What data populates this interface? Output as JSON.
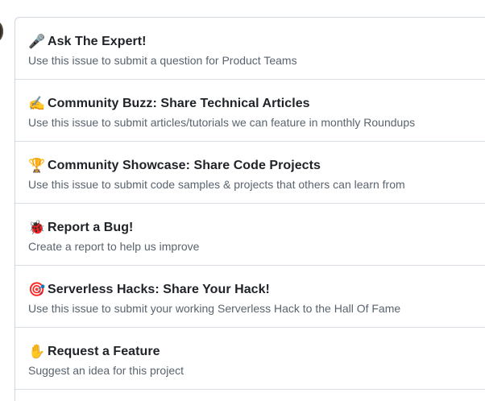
{
  "templates": [
    {
      "emoji": "🎤",
      "icon": "microphone-icon",
      "title": "Ask The Expert!",
      "description": "Use this issue to submit a question for Product Teams"
    },
    {
      "emoji": "✍️",
      "icon": "writing-hand-icon",
      "title": "Community Buzz: Share Technical Articles",
      "description": "Use this issue to submit articles/tutorials we can feature in monthly Roundups"
    },
    {
      "emoji": "🏆",
      "icon": "trophy-icon",
      "title": "Community Showcase: Share Code Projects",
      "description": "Use this issue to submit code samples & projects that others can learn from"
    },
    {
      "emoji": "🐞",
      "icon": "ladybug-icon",
      "title": "Report a Bug!",
      "description": "Create a report to help us improve"
    },
    {
      "emoji": "🎯",
      "icon": "target-icon",
      "title": "Serverless Hacks: Share Your Hack!",
      "description": "Use this issue to submit your working Serverless Hack to the Hall Of Fame"
    },
    {
      "emoji": "✋",
      "icon": "raised-hand-icon",
      "title": "Request a Feature",
      "description": "Suggest an idea for this project"
    }
  ]
}
